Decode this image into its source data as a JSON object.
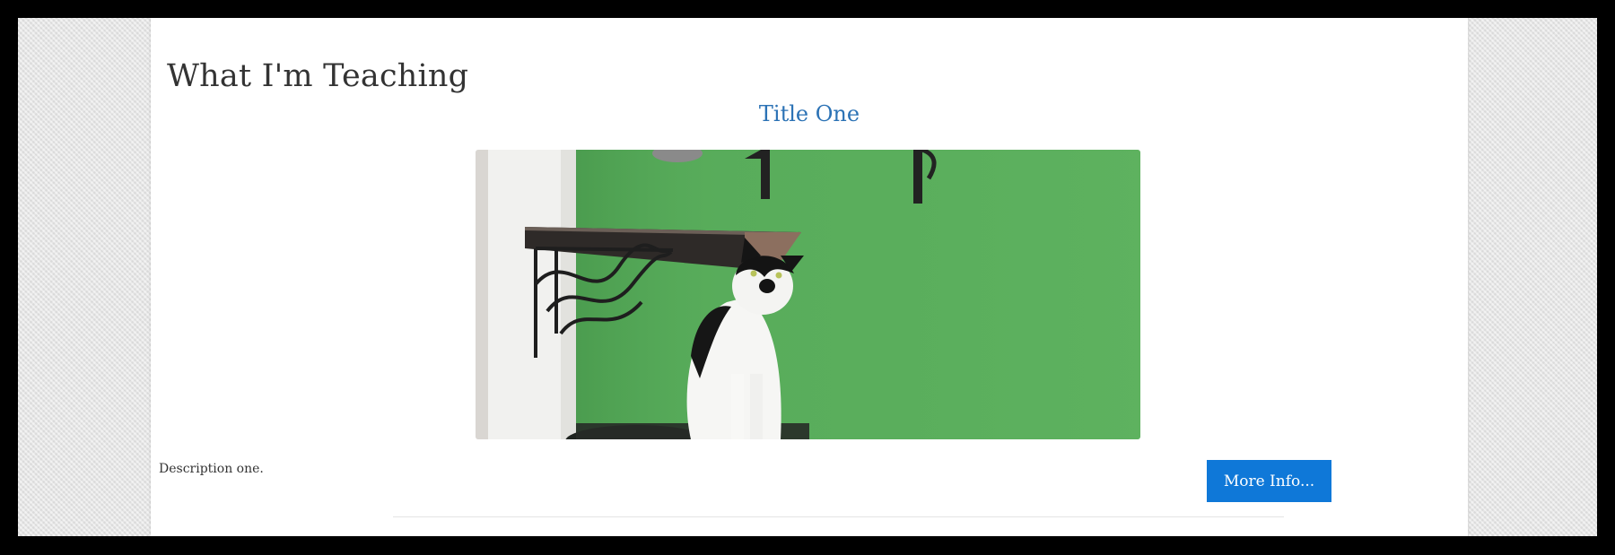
{
  "page": {
    "heading": "What I'm Teaching"
  },
  "course": {
    "title": "Title One",
    "description": "Description one.",
    "button_label": "More Info...",
    "image_description": "black-and-white cat sitting in front of a green wall under a wall shelf"
  },
  "colors": {
    "link": "#2b72b5",
    "button": "#0f78d8",
    "wall_green": "#5aae5c",
    "background_gray": "#e6e6e6"
  }
}
